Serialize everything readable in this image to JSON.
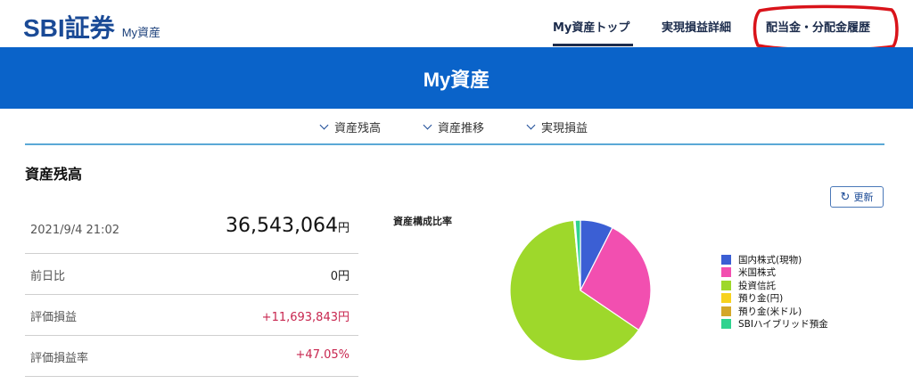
{
  "header": {
    "logo": "SBI証券",
    "logo_sub": "My資産",
    "nav": [
      {
        "label": "My資産トップ",
        "active": true
      },
      {
        "label": "実現損益詳細",
        "active": false
      },
      {
        "label": "配当金・分配金履歴",
        "active": false
      }
    ]
  },
  "banner": {
    "title": "My資産"
  },
  "subnav": [
    {
      "label": "資産残高"
    },
    {
      "label": "資産推移"
    },
    {
      "label": "実現損益"
    }
  ],
  "section": {
    "title": "資産残高",
    "refresh_label": "更新"
  },
  "balance": {
    "datetime": "2021/9/4 21:02",
    "total": "36,543,064",
    "total_unit": "円",
    "rows": [
      {
        "label": "前日比",
        "value": "0円"
      },
      {
        "label": "評価損益",
        "value": "+11,693,843円"
      },
      {
        "label": "評価損益率",
        "value": "+47.05%"
      }
    ]
  },
  "chart_data": {
    "type": "pie",
    "title": "資産構成比率",
    "categories": [
      "国内株式(現物)",
      "米国株式",
      "投資信託",
      "預り金(円)",
      "預り金(米ドル)",
      "SBIハイブリッド預金"
    ],
    "values": [
      7.5,
      27,
      64,
      0.2,
      0.1,
      1.2
    ],
    "colors": [
      "#3b5fd4",
      "#f24fb0",
      "#9ed82b",
      "#f7d21e",
      "#d4a72a",
      "#2fd38f"
    ],
    "legend_position": "right"
  }
}
